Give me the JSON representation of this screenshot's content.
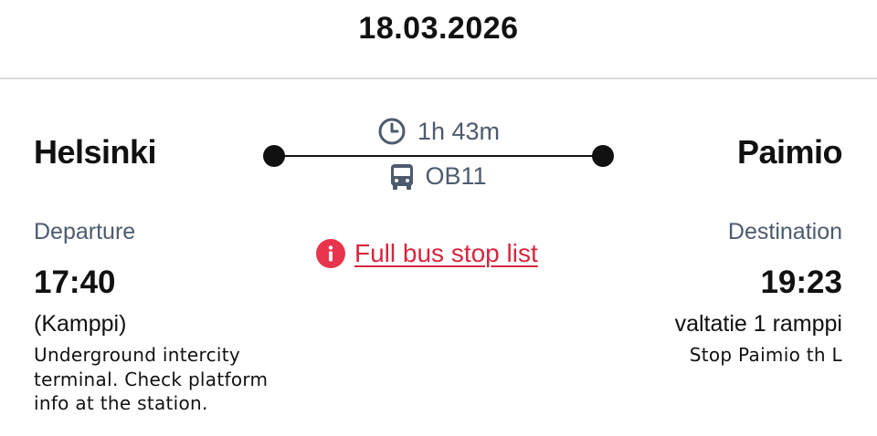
{
  "header": {
    "date": "18.03.2026"
  },
  "route": {
    "duration": "1h 43m",
    "line": "OB11",
    "stop_list_link": "Full bus stop list"
  },
  "origin": {
    "city": "Helsinki",
    "label": "Departure",
    "time": "17:40",
    "stop": "(Kamppi)",
    "info": "Underground intercity terminal. Check platform info at the station."
  },
  "destination": {
    "city": "Paimio",
    "label": "Destination",
    "time": "19:23",
    "stop": "valtatie 1 ramppi",
    "info": "Stop Paimio th L"
  },
  "icons": {
    "duration": "clock-icon",
    "vehicle": "bus-icon",
    "info": "info-icon"
  },
  "colors": {
    "link": "#d7263d",
    "muted_text": "#4d5a6e",
    "text": "#111111"
  }
}
